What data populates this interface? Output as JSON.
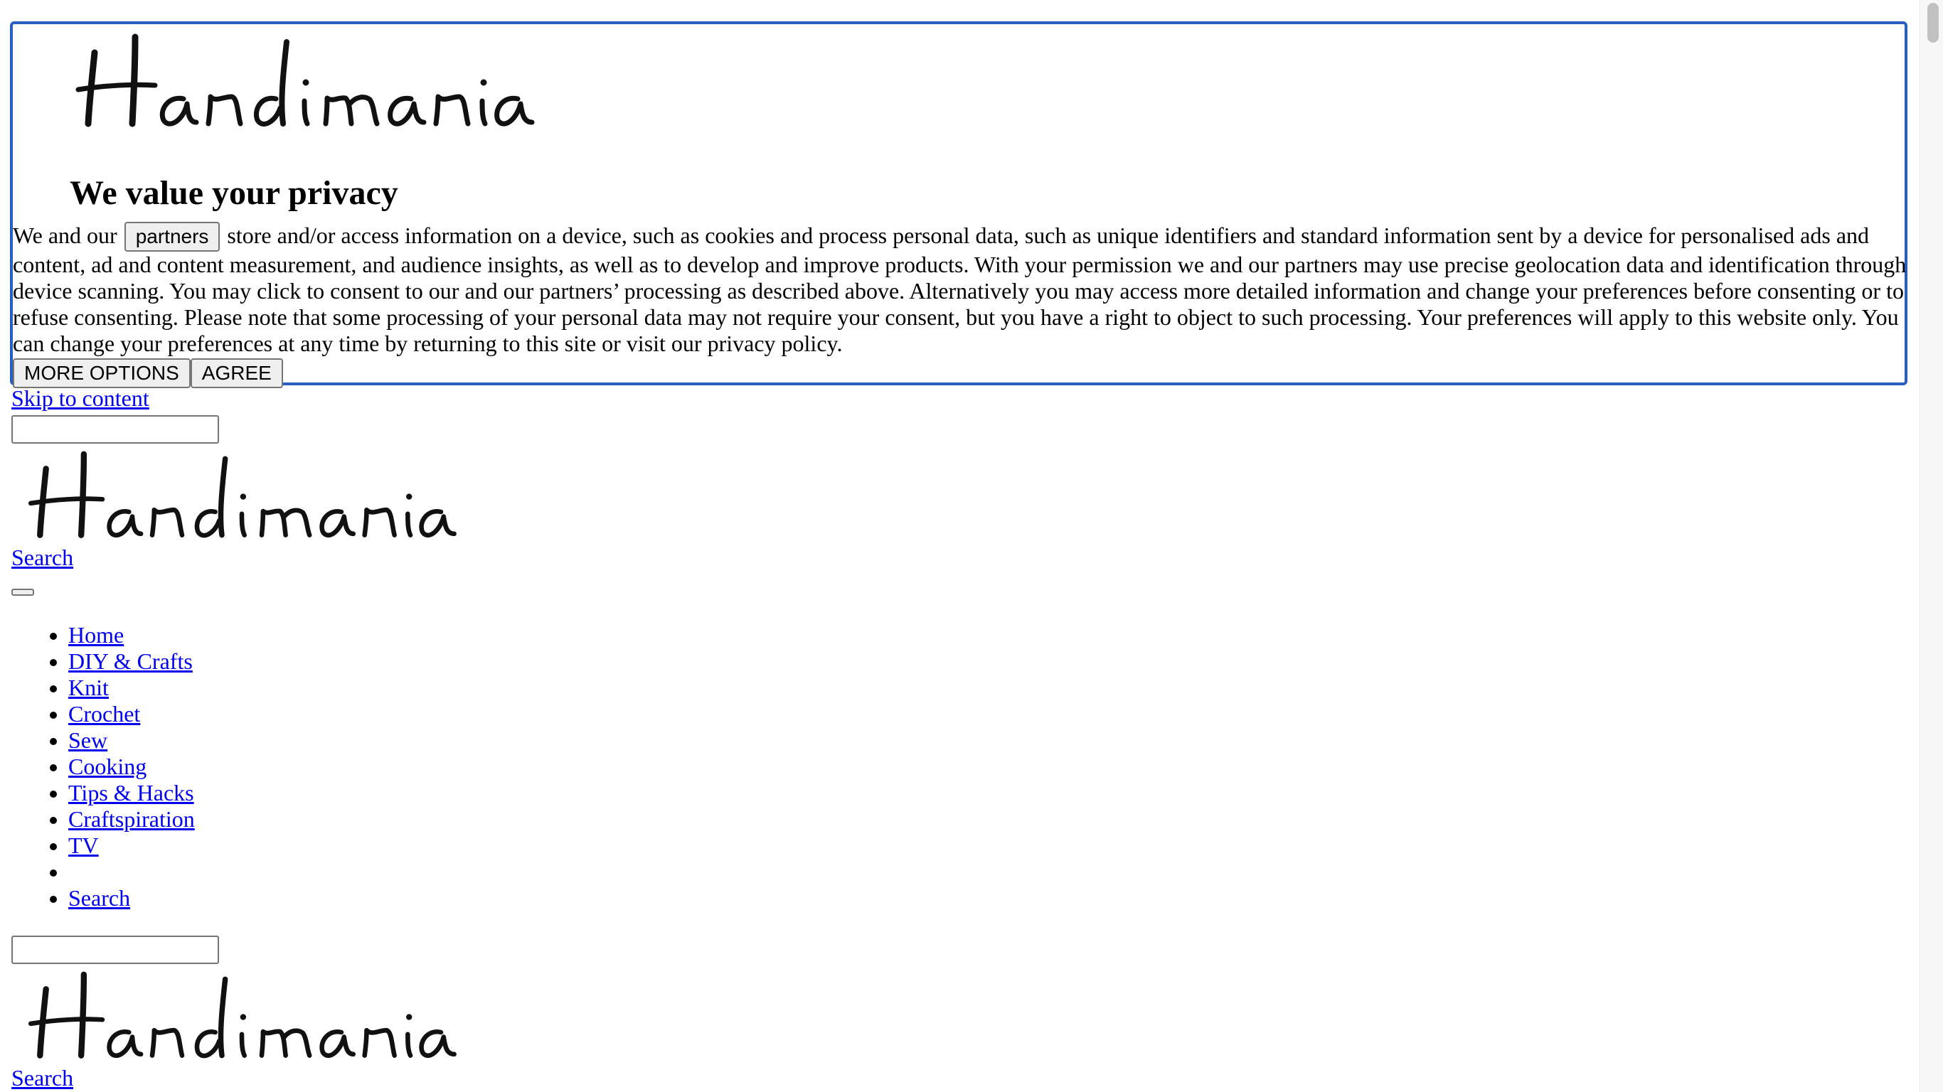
{
  "brand": {
    "name": "Handimania"
  },
  "consent": {
    "title": "We value your privacy",
    "text_before": "We and our",
    "partners_button": "partners",
    "text_after": "store and/or access information on a device, such as cookies and process personal data, such as unique identifiers and standard information sent by a device for personalised ads and content, ad and content measurement, and audience insights, as well as to develop and improve products. With your permission we and our partners may use precise geolocation data and identification through device scanning. You may click to consent to our and our partners’ processing as described above. Alternatively you may access more detailed information and change your preferences before consenting or to refuse consenting. Please note that some processing of your personal data may not require your consent, but you have a right to object to such processing. Your preferences will apply to this website only. You can change your preferences at any time by returning to this site or visit our privacy policy.",
    "more_options": "MORE OPTIONS",
    "agree": "AGREE"
  },
  "skip_link": "Skip to content",
  "search_link": "Search",
  "nav": {
    "items": [
      "Home",
      "DIY & Crafts",
      "Knit",
      "Crochet",
      "Sew",
      "Cooking",
      "Tips & Hacks",
      "Craftspiration",
      "TV",
      "",
      "Search"
    ]
  },
  "colors": {
    "link": "#0000ee",
    "consent_border": "#2a5fbf"
  }
}
